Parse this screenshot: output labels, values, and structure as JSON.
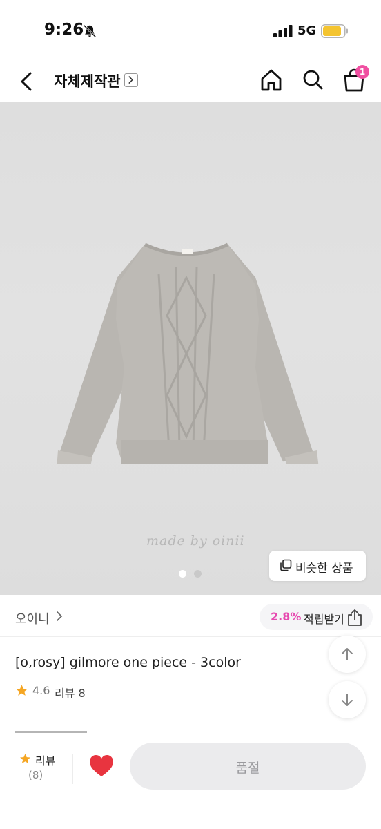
{
  "status_bar": {
    "time": "9:26",
    "network": "5G",
    "battery_color": "#f4c430",
    "icons": [
      "bell-slash-icon",
      "signal-icon",
      "battery-icon"
    ]
  },
  "header": {
    "title": "자체제작관",
    "cart_count": "1",
    "badge_color": "#f04fa1",
    "icons": [
      "back-arrow-icon",
      "chevron-right-icon",
      "home-icon",
      "search-icon",
      "shopping-bag-icon"
    ]
  },
  "gallery": {
    "watermark": "made by oinii",
    "page_count": 2,
    "current_page": 1,
    "similar_button_label": "비슷한 상품"
  },
  "brand": {
    "name": "오이니",
    "reward_percent": "2.8%",
    "reward_label": "적립받기",
    "accent_color": "#e64ab0"
  },
  "product": {
    "title": "[o,rosy] gilmore one piece - 3color",
    "rating": "4.6",
    "review_link": "리뷰 8",
    "star_color": "#f5a623"
  },
  "bottom_bar": {
    "review_label": "리뷰",
    "review_count": "(8)",
    "wish_color": "#e8343f",
    "cta_label": "품절"
  }
}
